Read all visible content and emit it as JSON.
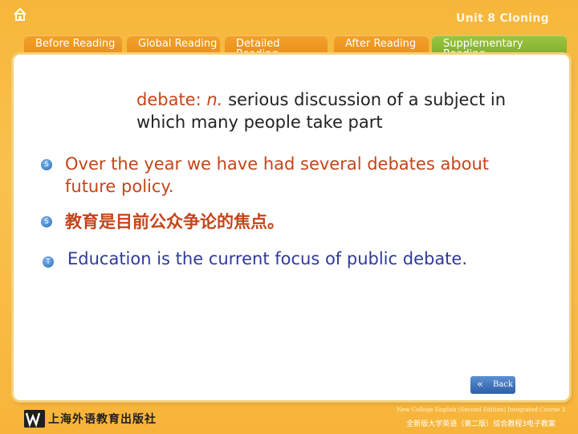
{
  "header": {
    "unit_title": "Unit 8 Cloning"
  },
  "tabs": [
    {
      "label": "Before Reading"
    },
    {
      "label": "Global Reading"
    },
    {
      "label": "Detailed Reading"
    },
    {
      "label": "After Reading"
    },
    {
      "label": "Supplementary Reading"
    }
  ],
  "content": {
    "word": "debate:",
    "pos": "n.",
    "definition": "serious discussion of a subject in which many people take part",
    "bullet_s": "S",
    "bullet_t": "T",
    "sentence1": "Over the year we have had several debates about future policy.",
    "sentence2_cn": "教育是目前公众争论的焦点。",
    "sentence3": "Education is the current focus of public debate."
  },
  "nav": {
    "back_label": "Back",
    "back_icon": "double-chevron-left-icon"
  },
  "footer": {
    "publisher": "上海外语教育出版社",
    "course_en": "New College English (Second Edition) Integrated Course 3",
    "course_cn": "全新版大学英语（第二版）综合教程3电子教案"
  },
  "colors": {
    "background": "#f9c24e",
    "tab": "#e88c18",
    "active_tab": "#8db735",
    "accent_text": "#c4451a",
    "blue_text": "#2e3a9a"
  }
}
